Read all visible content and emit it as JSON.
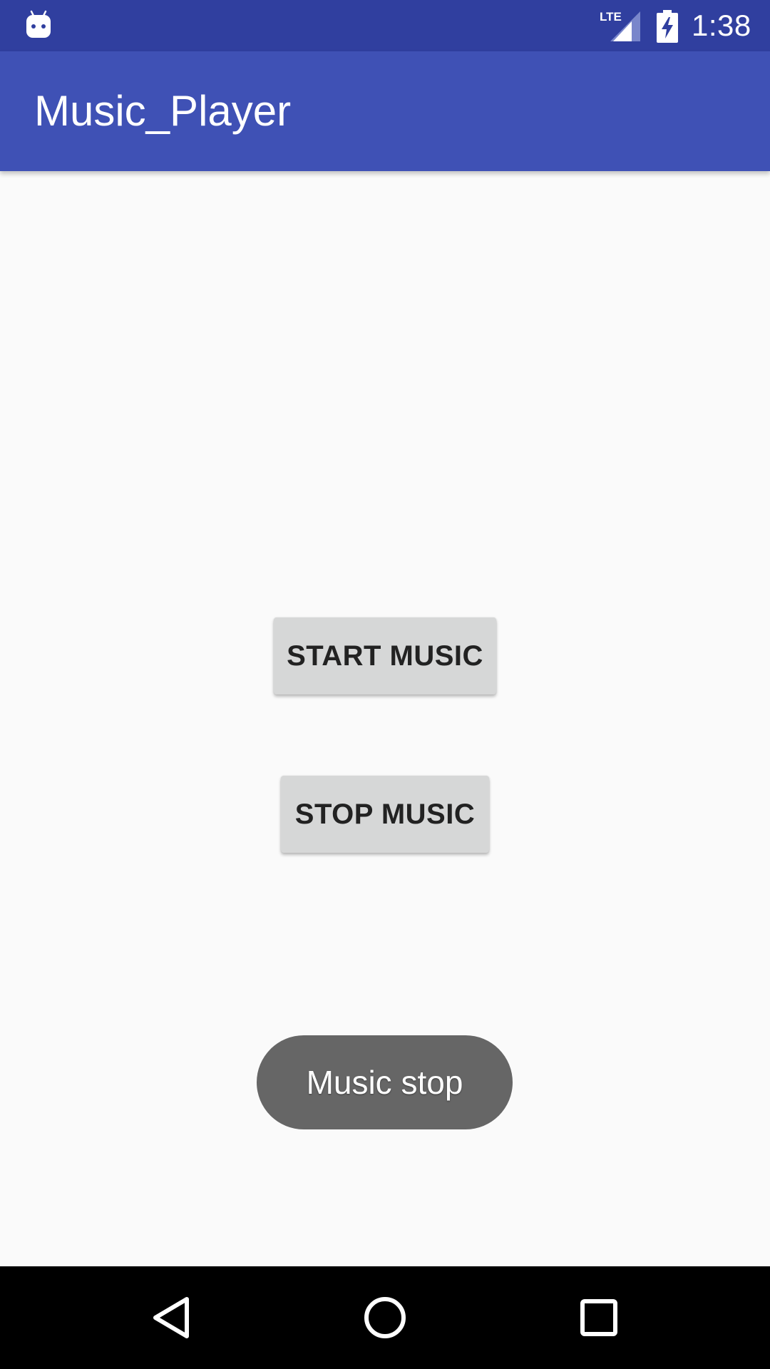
{
  "status_bar": {
    "time": "1:38",
    "network_label": "LTE",
    "icons": [
      "android-notification-icon",
      "lte-signal-icon",
      "battery-charging-icon"
    ]
  },
  "app_bar": {
    "title": "Music_Player"
  },
  "main": {
    "start_button_label": "START MUSIC",
    "stop_button_label": "STOP MUSIC"
  },
  "toast": {
    "message": "Music stop"
  },
  "nav_bar": {
    "icons": [
      "back-icon",
      "home-icon",
      "recents-icon"
    ]
  },
  "colors": {
    "status_bar": "#303f9f",
    "app_bar": "#3f51b5",
    "background": "#fafafa",
    "button": "#d6d7d7",
    "toast": "#666666",
    "nav_bar": "#000000"
  }
}
